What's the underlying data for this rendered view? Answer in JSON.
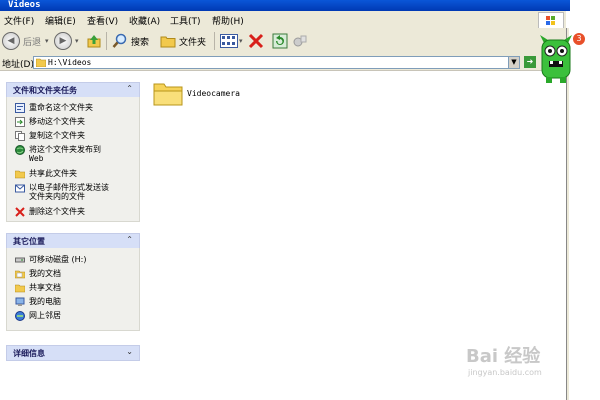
{
  "window": {
    "title": "Videos"
  },
  "menu": {
    "items": [
      "文件(F)",
      "编辑(E)",
      "查看(V)",
      "收藏(A)",
      "工具(T)",
      "帮助(H)"
    ]
  },
  "toolbar": {
    "back_label": "后退",
    "search_label": "搜索",
    "folders_label": "文件夹"
  },
  "address": {
    "label": "地址(D)",
    "value": "H:\\Videos"
  },
  "tasks_panel": {
    "title": "文件和文件夹任务",
    "items": [
      {
        "label": "重命名这个文件夹",
        "icon": "rename-icon"
      },
      {
        "label": "移动这个文件夹",
        "icon": "move-icon"
      },
      {
        "label": "复制这个文件夹",
        "icon": "copy-icon"
      },
      {
        "label": "将这个文件夹发布到 Web",
        "line1": "将这个文件夹发布到",
        "line2": "Web",
        "icon": "globe-icon"
      },
      {
        "label": "共享此文件夹",
        "icon": "share-icon"
      },
      {
        "label": "以电子邮件形式发送该文件夹内的文件",
        "line1": "以电子邮件形式发送该",
        "line2": "文件夹内的文件",
        "icon": "email-icon"
      },
      {
        "label": "删除这个文件夹",
        "icon": "delete-icon"
      }
    ]
  },
  "places_panel": {
    "title": "其它位置",
    "items": [
      {
        "label": "可移动磁盘 (H:)",
        "icon": "drive-icon"
      },
      {
        "label": "我的文档",
        "icon": "documents-icon"
      },
      {
        "label": "共享文档",
        "icon": "shared-folder-icon"
      },
      {
        "label": "我的电脑",
        "icon": "computer-icon"
      },
      {
        "label": "网上邻居",
        "icon": "network-icon"
      }
    ]
  },
  "details_panel": {
    "title": "详细信息"
  },
  "content": {
    "folders": [
      {
        "name": "Videocamera"
      }
    ]
  },
  "notification": {
    "count": "3"
  },
  "watermark": {
    "main": "Bai 经验",
    "sub": "jingyan.baidu.com"
  }
}
